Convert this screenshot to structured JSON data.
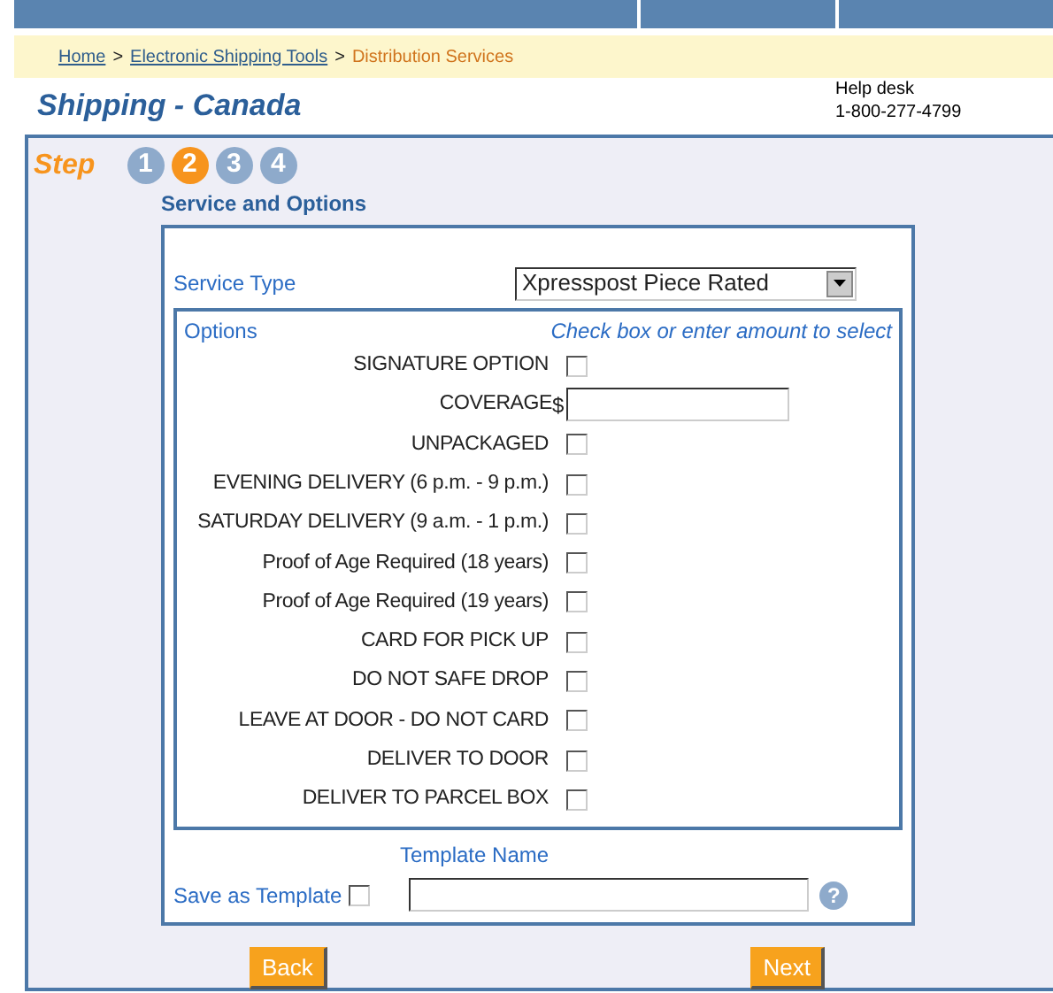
{
  "breadcrumb": [
    {
      "label": "Home",
      "link": true
    },
    {
      "label": "Electronic Shipping Tools",
      "link": true
    },
    {
      "label": "Distribution Services",
      "link": false
    }
  ],
  "breadcrumb_separator": ">",
  "page_title": "Shipping - Canada",
  "help_desk": {
    "label": "Help desk",
    "phone": "1-800-277-4799"
  },
  "steps": {
    "label": "Step",
    "items": [
      {
        "number": "1",
        "selected": false
      },
      {
        "number": "2",
        "selected": true
      },
      {
        "number": "3",
        "selected": false
      },
      {
        "number": "4",
        "selected": false
      }
    ]
  },
  "section_title": "Service and Options",
  "service_type": {
    "label": "Service Type",
    "value": "Xpresspost Piece Rated"
  },
  "options": {
    "label": "Options",
    "hint": "Check box or enter amount to select",
    "items": [
      {
        "kind": "checkbox",
        "label": "SIGNATURE OPTION",
        "checked": false
      },
      {
        "kind": "amount",
        "label": "COVERAGE",
        "currency": "$"
      },
      {
        "kind": "checkbox",
        "label": "UNPACKAGED",
        "checked": false
      },
      {
        "kind": "checkbox",
        "label": "EVENING DELIVERY (6 p.m. - 9 p.m.)",
        "checked": false
      },
      {
        "kind": "checkbox",
        "label": "SATURDAY DELIVERY (9 a.m. - 1 p.m.)",
        "checked": false
      },
      {
        "kind": "checkbox",
        "label": "Proof of Age Required (18 years)",
        "checked": false
      },
      {
        "kind": "checkbox",
        "label": "Proof of Age Required (19 years)",
        "checked": false
      },
      {
        "kind": "checkbox",
        "label": "CARD FOR PICK UP",
        "checked": false
      },
      {
        "kind": "checkbox",
        "label": "DO NOT SAFE DROP",
        "checked": false
      },
      {
        "kind": "checkbox",
        "label": "LEAVE AT DOOR - DO NOT CARD",
        "checked": false
      },
      {
        "kind": "checkbox",
        "label": "DELIVER TO DOOR",
        "checked": false
      },
      {
        "kind": "checkbox",
        "label": "DELIVER TO PARCEL BOX",
        "checked": false
      }
    ]
  },
  "template": {
    "name_label": "Template Name",
    "save_label": "Save as Template",
    "save_checked": false,
    "help": "?"
  },
  "buttons": [
    "Back",
    "Next"
  ]
}
